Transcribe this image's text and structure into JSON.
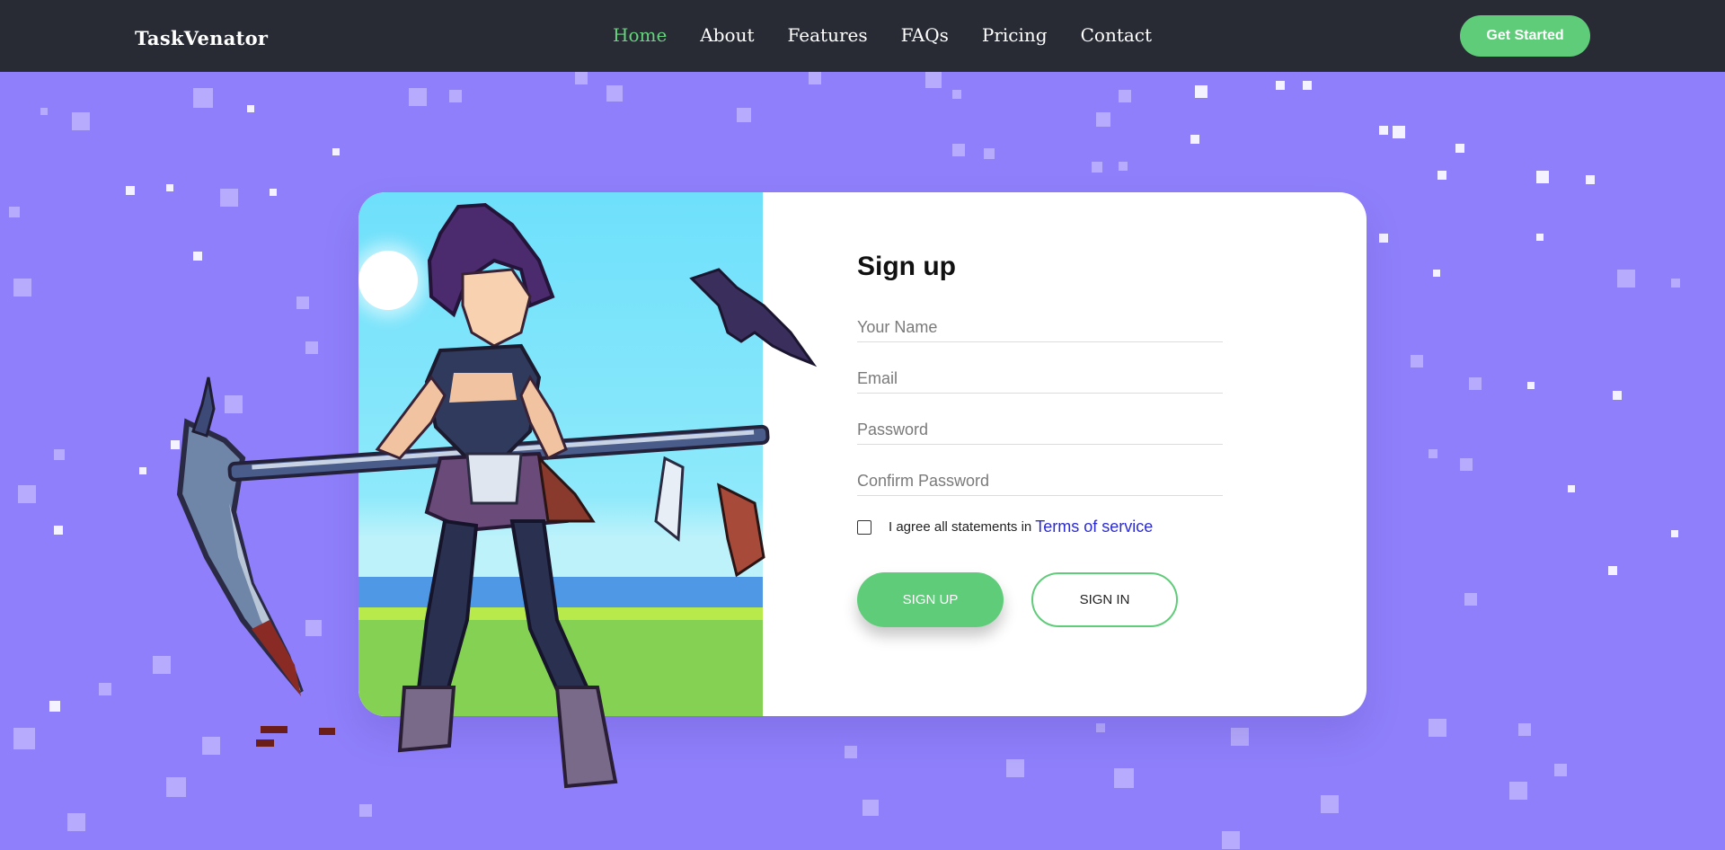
{
  "brand": "TaskVenator",
  "nav": {
    "links": [
      "Home",
      "About",
      "Features",
      "FAQs",
      "Pricing",
      "Contact"
    ],
    "active": "Home",
    "cta_label": "Get Started"
  },
  "form": {
    "title": "Sign up",
    "name_placeholder": "Your Name",
    "email_placeholder": "Email",
    "password_placeholder": "Password",
    "confirm_placeholder": "Confirm Password",
    "agree_text": "I agree all statements in",
    "terms_label": "Terms of service",
    "signup_label": "SIGN UP",
    "signin_label": "SIGN IN"
  },
  "colors": {
    "background": "#8f7ffa",
    "navbar": "#282b34",
    "accent": "#5fcc79",
    "active_link": "#66d47e",
    "terms_link": "#2b2bd6"
  },
  "icons": {
    "artwork": "pixel-art-scythe-girl-with-crow"
  }
}
